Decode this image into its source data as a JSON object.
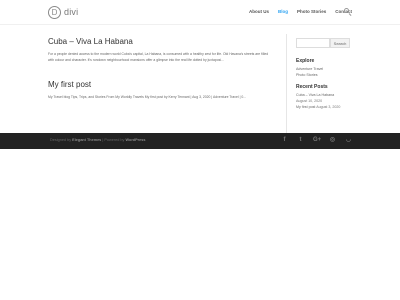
{
  "header": {
    "logo_letter": "D",
    "logo_text": "divi",
    "nav": [
      "About Us",
      "Blog",
      "Photo Stories",
      "Contact"
    ],
    "active": "Blog"
  },
  "posts": [
    {
      "title": "Cuba – Viva La Habana",
      "excerpt": "For a people denied access to the modern world Cuba's capital, La Habana, is consumed with a healthy zest for life. Old Havana's streets are filled with colour and character. It's rundown neighbourhood mansions offer a glimpse into the real life dotted by juxtaposi..."
    },
    {
      "title": "My first post",
      "meta": "My Travel blog Tips, Trips, and Stories From My Worldly Travels My first post by Kerry Tennant | Aug 3, 2020 | Adventure Travel | 0..."
    }
  ],
  "sidebar": {
    "search_placeholder": "",
    "search_button": "Search",
    "explore_title": "Explore",
    "explore_items": [
      "Adventure Travel",
      "Photo Stories"
    ],
    "recent_title": "Recent Posts",
    "recent_items": [
      {
        "title": "Cuba – Viva La Habana",
        "date": "August 10, 2020"
      },
      {
        "title": "My first post",
        "date": "August 3, 2020"
      }
    ]
  },
  "footer": {
    "designed_by_label": "Designed by",
    "designer": "Elegant Themes",
    "separator": " | Powered by ",
    "powered": "WordPress"
  },
  "social_icons": [
    "facebook-icon",
    "twitter-icon",
    "google-plus-icon",
    "instagram-icon",
    "rss-icon"
  ],
  "colors": {
    "accent": "#2ea3f2",
    "footer_bg": "#222222"
  }
}
